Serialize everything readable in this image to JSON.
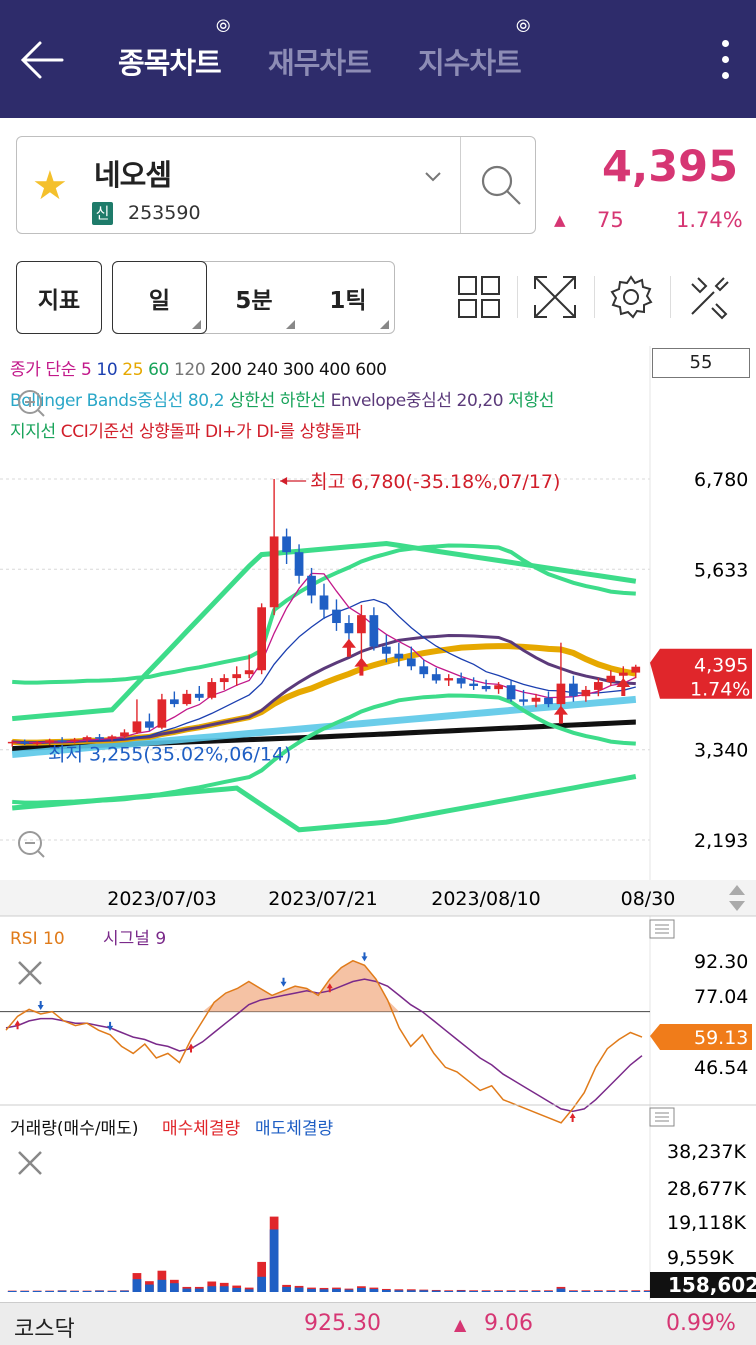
{
  "header": {
    "tabs": [
      {
        "label": "종목차트",
        "active": true
      },
      {
        "label": "재무차트",
        "active": false
      },
      {
        "label": "지수차트",
        "active": false
      }
    ],
    "icons": [
      "back-arrow-icon",
      "more-vert-icon"
    ]
  },
  "stock": {
    "name": "네오셈",
    "market_badge": "신",
    "code": "253590",
    "price": "4,395",
    "change_arrow": "▲",
    "change": "75",
    "change_pct": "1.74%"
  },
  "controls": {
    "indicator_button": "지표",
    "periods": [
      "일",
      "5분",
      "1틱"
    ],
    "tool_icons": [
      "grid-layout-icon",
      "fullscreen-icon",
      "settings-gear-icon",
      "tools-icon"
    ]
  },
  "legend": {
    "line1": [
      {
        "text": "종가 단순",
        "color": "#c2188a"
      },
      {
        "text": "5",
        "color": "#c2188a"
      },
      {
        "text": "10",
        "color": "#1b3fb0"
      },
      {
        "text": "25",
        "color": "#e6a800"
      },
      {
        "text": "60",
        "color": "#18a35a"
      },
      {
        "text": "120",
        "color": "#777777"
      },
      {
        "text": "200 240 300 400 600",
        "color": "#111111"
      }
    ],
    "line2": [
      {
        "text": "Bollinger Bands중심선 80,2",
        "color": "#2aa7c8"
      },
      {
        "text": "상한선 하한선",
        "color": "#18a35a"
      },
      {
        "text": "Envelope중심선 20,20",
        "color": "#5b3a7a"
      },
      {
        "text": "저항선",
        "color": "#18a35a"
      }
    ],
    "line3": [
      {
        "text": "지지선",
        "color": "#18a35a"
      },
      {
        "text": "CCI기준선 상향돌파 DI+가 DI-를 상향돌파",
        "color": "#d11e2a"
      }
    ],
    "box_value": "55"
  },
  "chart_data": {
    "type": "candlestick",
    "price_axis": [
      "6,780",
      "5,633",
      "4,395",
      "3,340",
      "2,193"
    ],
    "price_ticks": [
      6780,
      5633,
      3340,
      2193
    ],
    "date_labels": [
      "2023/07/03",
      "2023/07/21",
      "2023/08/10",
      "08/30"
    ],
    "high_annotation": "최고 6,780(-35.18%,07/17)",
    "low_annotation": "최저 3,255(35.02%,06/14)",
    "current_price_tag": {
      "price": "4,395",
      "pct": "1.74%"
    },
    "candles": [
      [
        3430,
        3460,
        3380,
        3440
      ],
      [
        3440,
        3470,
        3400,
        3420
      ],
      [
        3420,
        3450,
        3390,
        3430
      ],
      [
        3430,
        3480,
        3400,
        3460
      ],
      [
        3460,
        3500,
        3430,
        3450
      ],
      [
        3450,
        3490,
        3420,
        3470
      ],
      [
        3470,
        3520,
        3440,
        3500
      ],
      [
        3500,
        3540,
        3460,
        3480
      ],
      [
        3480,
        3530,
        3450,
        3510
      ],
      [
        3510,
        3600,
        3480,
        3560
      ],
      [
        3560,
        3980,
        3540,
        3700
      ],
      [
        3700,
        3800,
        3580,
        3620
      ],
      [
        3620,
        4050,
        3600,
        3980
      ],
      [
        3980,
        4080,
        3880,
        3920
      ],
      [
        3920,
        4100,
        3900,
        4050
      ],
      [
        4050,
        4150,
        3960,
        4000
      ],
      [
        4000,
        4250,
        3980,
        4200
      ],
      [
        4200,
        4300,
        4100,
        4250
      ],
      [
        4250,
        4400,
        4150,
        4300
      ],
      [
        4300,
        4550,
        4250,
        4350
      ],
      [
        4350,
        5200,
        4300,
        5150
      ],
      [
        5150,
        6780,
        5050,
        6050
      ],
      [
        6050,
        6150,
        5700,
        5850
      ],
      [
        5850,
        5950,
        5450,
        5550
      ],
      [
        5550,
        5650,
        5200,
        5300
      ],
      [
        5300,
        5450,
        5000,
        5120
      ],
      [
        5120,
        5250,
        4850,
        4950
      ],
      [
        4950,
        5050,
        4700,
        4820
      ],
      [
        4820,
        5180,
        4460,
        5050
      ],
      [
        5050,
        5150,
        4600,
        4650
      ],
      [
        4650,
        4800,
        4450,
        4560
      ],
      [
        4560,
        4700,
        4400,
        4500
      ],
      [
        4500,
        4650,
        4350,
        4400
      ],
      [
        4400,
        4480,
        4250,
        4300
      ],
      [
        4300,
        4380,
        4180,
        4220
      ],
      [
        4220,
        4300,
        4150,
        4250
      ],
      [
        4250,
        4320,
        4120,
        4180
      ],
      [
        4180,
        4260,
        4100,
        4150
      ],
      [
        4150,
        4230,
        4080,
        4110
      ],
      [
        4110,
        4200,
        4050,
        4160
      ],
      [
        4160,
        4220,
        3950,
        3980
      ],
      [
        3980,
        4100,
        3900,
        3950
      ],
      [
        3950,
        4050,
        3880,
        4000
      ],
      [
        4000,
        4080,
        3880,
        3920
      ],
      [
        3920,
        4700,
        3850,
        4180
      ],
      [
        4180,
        4280,
        3950,
        4020
      ],
      [
        4020,
        4150,
        3950,
        4100
      ],
      [
        4100,
        4250,
        4020,
        4200
      ],
      [
        4200,
        4350,
        4150,
        4280
      ],
      [
        4280,
        4400,
        4200,
        4320
      ],
      [
        4320,
        4420,
        4250,
        4395
      ]
    ],
    "rsi": {
      "title": "RSI 10",
      "signal": "시그널 9",
      "axis": [
        "92.30",
        "77.04",
        "59.13",
        "46.54"
      ],
      "current": "59.13",
      "rsi_values": [
        62,
        68,
        71,
        69,
        70,
        66,
        64,
        65,
        62,
        60,
        55,
        52,
        56,
        50,
        52,
        48,
        58,
        66,
        74,
        78,
        80,
        83,
        80,
        77,
        79,
        81,
        80,
        77,
        84,
        89,
        92,
        90,
        84,
        75,
        63,
        55,
        60,
        52,
        46,
        44,
        40,
        36,
        38,
        32,
        30,
        28,
        26,
        24,
        22,
        28,
        35,
        46,
        54,
        58,
        61,
        59
      ],
      "signal_values": [
        63,
        64,
        66,
        67,
        67,
        66,
        65,
        65,
        64,
        63,
        61,
        59,
        58,
        56,
        55,
        53,
        54,
        57,
        61,
        65,
        69,
        73,
        75,
        76,
        77,
        78,
        79,
        78,
        79,
        81,
        83,
        84,
        83,
        81,
        77,
        73,
        70,
        66,
        62,
        58,
        54,
        50,
        47,
        43,
        40,
        37,
        34,
        31,
        28,
        27,
        28,
        32,
        37,
        42,
        47,
        51
      ]
    },
    "volume": {
      "title": "거래량(매수/매도)",
      "buy_label": "매수체결량",
      "sell_label": "매도체결량",
      "axis": [
        "38,237K",
        "28,677K",
        "19,118K",
        "9,559K"
      ],
      "current": "158,602",
      "max": 42000,
      "buy": [
        300,
        300,
        300,
        300,
        400,
        300,
        300,
        400,
        300,
        400,
        3800,
        2200,
        3600,
        2600,
        1000,
        1000,
        1700,
        1700,
        1200,
        800,
        4500,
        18500,
        1500,
        1300,
        900,
        800,
        900,
        700,
        1200,
        900,
        600,
        500,
        500,
        500,
        400,
        300,
        400,
        300,
        300,
        300,
        300,
        300,
        300,
        300,
        1000,
        300,
        300,
        300,
        300,
        300,
        300,
        300
      ],
      "sell": [
        400,
        400,
        400,
        400,
        500,
        400,
        400,
        500,
        400,
        500,
        5600,
        3200,
        6300,
        3600,
        1500,
        1500,
        3100,
        2700,
        1900,
        1300,
        8900,
        22300,
        2100,
        1800,
        1300,
        1200,
        1300,
        1000,
        1700,
        1300,
        900,
        800,
        800,
        700,
        600,
        500,
        600,
        500,
        500,
        500,
        500,
        500,
        500,
        500,
        1500,
        500,
        500,
        500,
        500,
        500,
        500,
        500
      ]
    }
  },
  "footer": {
    "index_name": "코스닥",
    "index_value": "925.30",
    "arrow": "▲",
    "change": "9.06",
    "change_pct": "0.99%"
  }
}
